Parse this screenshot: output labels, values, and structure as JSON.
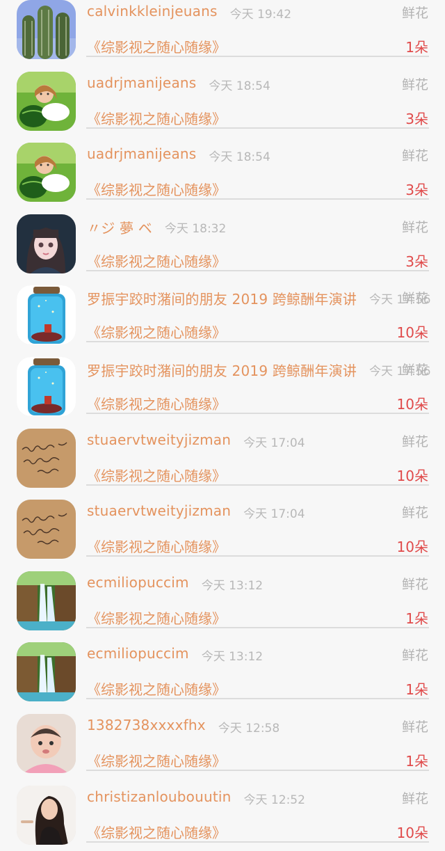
{
  "gifts": [
    {
      "username": "calvinkkleinjeuans",
      "time": "今天 19:42",
      "type": "鲜花",
      "book": "《综影视之随心随缘》",
      "count": "1朵",
      "avatar": "cactus"
    },
    {
      "username": "uadrjmanijeans",
      "time": "今天 18:54",
      "type": "鲜花",
      "book": "《综影视之随心随缘》",
      "count": "3朵",
      "avatar": "girl-watermelon"
    },
    {
      "username": "uadrjmanijeans",
      "time": "今天 18:54",
      "type": "鲜花",
      "book": "《综影视之随心随缘》",
      "count": "3朵",
      "avatar": "girl-watermelon"
    },
    {
      "username": "〃ジ 夢 ベ",
      "time": "今天 18:32",
      "type": "鲜花",
      "book": "《综影视之随心随缘》",
      "count": "3朵",
      "avatar": "anime-girl"
    },
    {
      "username": "罗振宇跤时潴间的朋友 2019 跨鲸酬年演讲",
      "time": "今天 17:56",
      "type": "鲜花",
      "book": "《综影视之随心随缘》",
      "count": "10朵",
      "avatar": "jar"
    },
    {
      "username": "罗振宇跤时潴间的朋友 2019 跨鲸酬年演讲",
      "time": "今天 17:56",
      "type": "鲜花",
      "book": "《综影视之随心随缘》",
      "count": "10朵",
      "avatar": "jar"
    },
    {
      "username": "stuaervtweityjizman",
      "time": "今天 17:04",
      "type": "鲜花",
      "book": "《综影视之随心随缘》",
      "count": "10朵",
      "avatar": "handwriting"
    },
    {
      "username": "stuaervtweityjizman",
      "time": "今天 17:04",
      "type": "鲜花",
      "book": "《综影视之随心随缘》",
      "count": "10朵",
      "avatar": "handwriting"
    },
    {
      "username": "ecmiliopuccim",
      "time": "今天 13:12",
      "type": "鲜花",
      "book": "《综影视之随心随缘》",
      "count": "1朵",
      "avatar": "waterfall"
    },
    {
      "username": "ecmiliopuccim",
      "time": "今天 13:12",
      "type": "鲜花",
      "book": "《综影视之随心随缘》",
      "count": "1朵",
      "avatar": "waterfall"
    },
    {
      "username": "1382738xxxxfhx",
      "time": "今天 12:58",
      "type": "鲜花",
      "book": "《综影视之随心随缘》",
      "count": "1朵",
      "avatar": "baby"
    },
    {
      "username": "christizanloubouutin",
      "time": "今天 12:52",
      "type": "鲜花",
      "book": "《综影视之随心随缘》",
      "count": "10朵",
      "avatar": "woman"
    }
  ],
  "colors": {
    "username": "#e4935e",
    "book": "#e4935e",
    "count": "#e04a4a",
    "muted": "#b8b8b8",
    "background": "#f7f7f7"
  }
}
